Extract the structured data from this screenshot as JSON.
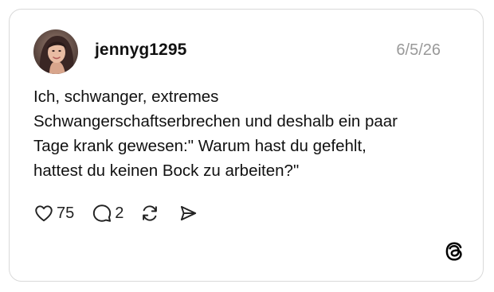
{
  "post": {
    "username": "jennyg1295",
    "date": "6/5/26",
    "text": "Ich, schwanger, extremes\nSchwangerschaftserbrechen und deshalb ein paar\nTage krank gewesen:\" Warum hast du gefehlt,\nhattest du keinen Bock zu arbeiten?\"",
    "likes": "75",
    "replies": "2"
  },
  "icons": {
    "like": "heart-icon",
    "reply": "speech-bubble-icon",
    "repost": "repost-arrows-icon",
    "share": "send-icon",
    "brand": "threads-logo-icon"
  },
  "colors": {
    "text": "#111111",
    "muted": "#999999",
    "border": "#d9d9d9"
  }
}
